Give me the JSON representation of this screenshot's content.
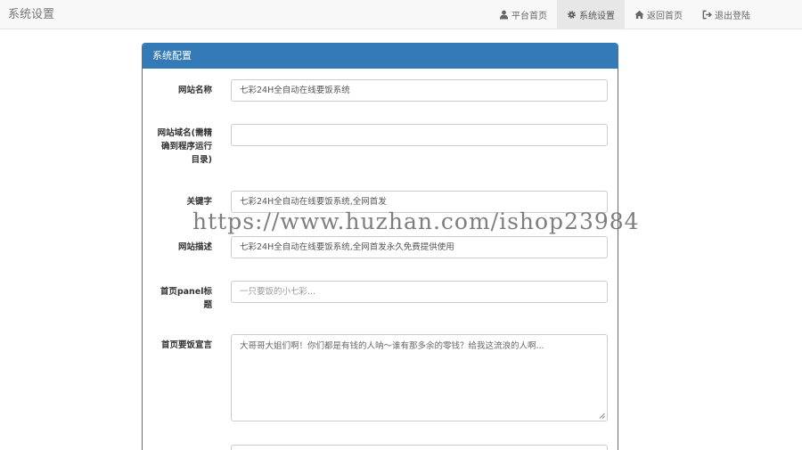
{
  "navbar": {
    "brand": "系统设置",
    "items": [
      {
        "label": "平台首页",
        "icon": "user-icon",
        "active": false
      },
      {
        "label": "系统设置",
        "icon": "gear-icon",
        "active": true
      },
      {
        "label": "返回首页",
        "icon": "home-icon",
        "active": false
      },
      {
        "label": "退出登陆",
        "icon": "logout-icon",
        "active": false
      }
    ]
  },
  "panel": {
    "title": "系统配置",
    "fields": {
      "site_name": {
        "label": "网站名称",
        "value": "七彩24H全自动在线要饭系统"
      },
      "site_domain": {
        "label": "网站域名(需精确到程序运行目录)",
        "label_lines": [
          "网站域名(需精",
          "确到程序运行",
          "目录)"
        ],
        "value": ""
      },
      "keywords": {
        "label": "关键字",
        "value": "七彩24H全自动在线要饭系统,全网首发"
      },
      "description": {
        "label": "网站描述",
        "value": "七彩24H全自动在线要饭系统,全网首发永久免费提供使用"
      },
      "panel_title": {
        "label": "首页panel标题",
        "label_lines": [
          "首页panel标",
          "题"
        ],
        "value": "一只要饭的小七彩..."
      },
      "slogan": {
        "label": "首页要饭宣言",
        "value": "大哥哥大姐们啊！你们都是有钱的人呐～谁有那多余的零钱？给我这流浪的人啊..."
      }
    }
  },
  "watermark": "https://www.huzhan.com/ishop23984",
  "colors": {
    "primary": "#337ab7",
    "navbar_bg": "#f8f8f8",
    "active_nav_bg": "#e7e7e7"
  }
}
